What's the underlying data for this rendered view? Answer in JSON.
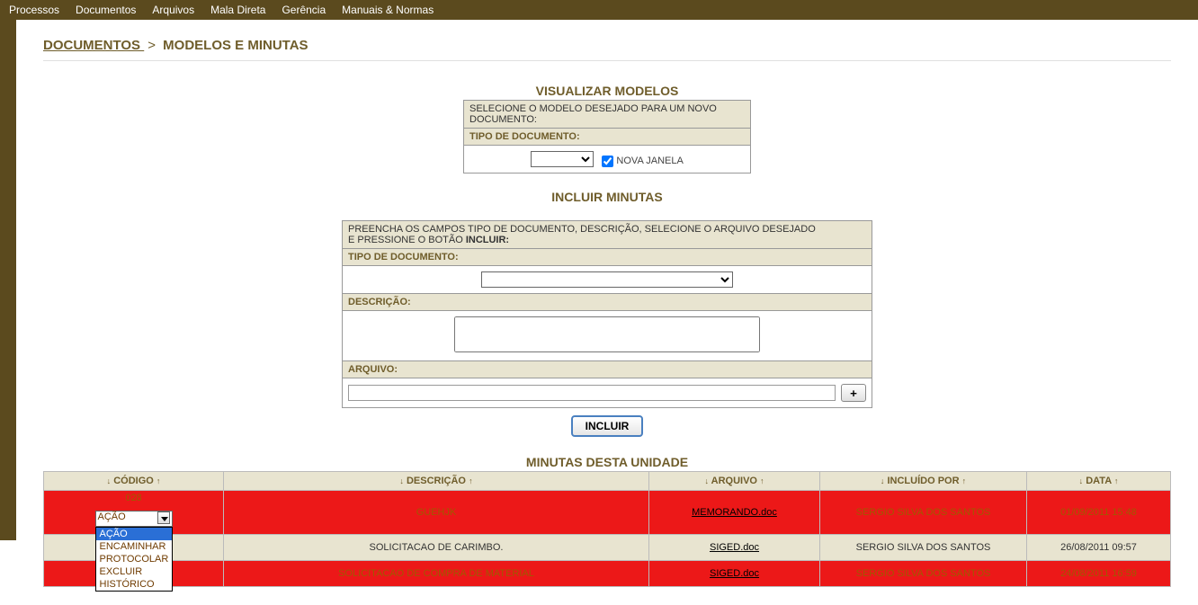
{
  "topbar": [
    "Processos",
    "Documentos",
    "Arquivos",
    "Mala Direta",
    "Gerência",
    "Manuais & Normas"
  ],
  "breadcrumb": {
    "link": "DOCUMENTOS ",
    "sep": ">",
    "current": "MODELOS E MINUTAS"
  },
  "vm": {
    "title": "VISUALIZAR MODELOS",
    "header": "SELECIONE O MODELO DESEJADO PARA UM NOVO DOCUMENTO:",
    "tipo": "TIPO DE DOCUMENTO:",
    "nova_janela": "NOVA JANELA"
  },
  "im": {
    "title": "INCLUIR MINUTAS",
    "header_a": "PREENCHA OS CAMPOS TIPO DE DOCUMENTO, DESCRIÇÃO, SELECIONE O ARQUIVO DESEJADO",
    "header_b": "E PRESSIONE O BOTÃO ",
    "header_b_bold": "INCLUIR:",
    "tipo": "TIPO DE DOCUMENTO:",
    "desc": "DESCRIÇÃO:",
    "arquivo": "ARQUIVO:",
    "plus": "+",
    "btn": "INCLUIR"
  },
  "grid": {
    "title": "MINUTAS DESTA UNIDADE",
    "headers": {
      "codigo": "CÓDIGO",
      "desc": "DESCRIÇÃO",
      "arquivo": "ARQUIVO",
      "user": "INCLUÍDO POR",
      "data": "DATA"
    },
    "action_options": [
      "AÇÃO",
      "ENCAMINHAR",
      "PROTOCOLAR",
      "EXCLUIR",
      "HISTÓRICO"
    ],
    "action_selected": "AÇÃO",
    "rows": [
      {
        "codigo": "028",
        "desc": "GUEHJK",
        "arquivo": "MEMORANDO.doc",
        "user": "SERGIO SILVA DOS SANTOS",
        "data": "01/09/2011 15:48",
        "red": true,
        "dropdown": true
      },
      {
        "codigo": "",
        "desc": "SOLICITACAO DE CARIMBO.",
        "arquivo": "SIGED.doc",
        "user": "SERGIO SILVA DOS SANTOS",
        "data": "26/08/2011 09:57",
        "red": false
      },
      {
        "codigo": "",
        "desc": "SOLICITACAO DE COMPRA DE MATERIAL",
        "arquivo": "SIGED.doc",
        "user": "SERGIO SILVA DOS SANTOS",
        "data": "24/08/2011 16:59",
        "red": true
      }
    ]
  }
}
